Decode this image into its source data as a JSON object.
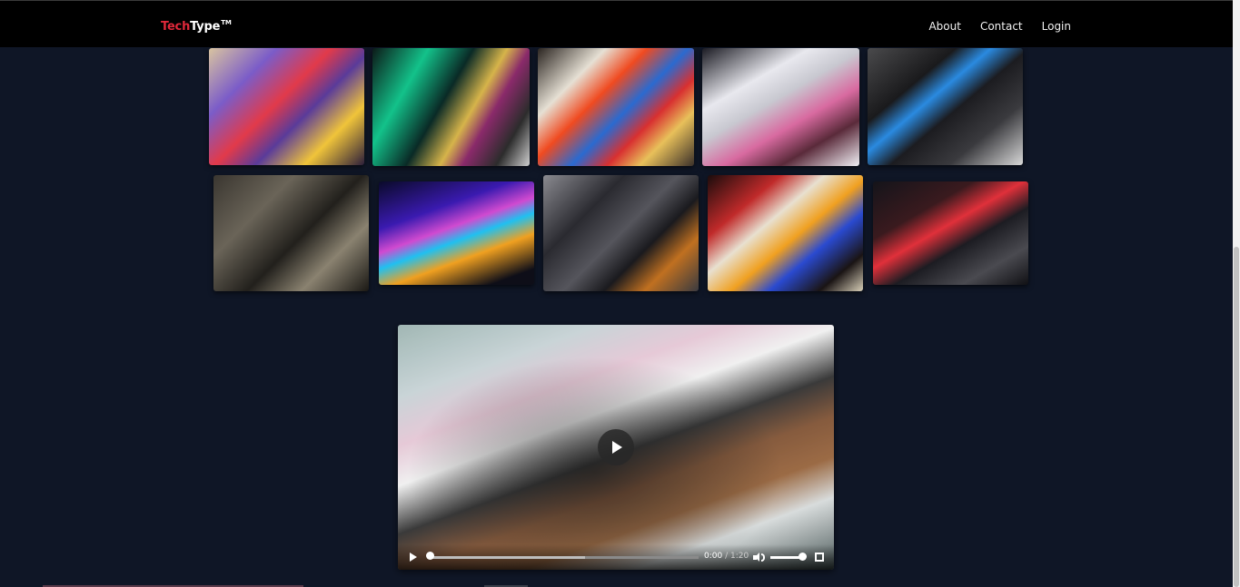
{
  "header": {
    "brand_part1": "Tech",
    "brand_part2": "Type",
    "brand_mark": "TM",
    "nav": [
      {
        "label": "About"
      },
      {
        "label": "Contact"
      },
      {
        "label": "Login"
      }
    ]
  },
  "gallery": {
    "rows": [
      [
        "artisan-keycaps-purple",
        "green-glow-keyboard",
        "character-keycaps",
        "white-pink-keyboards",
        "keyboard-display-case"
      ],
      [
        "beige-retro-keyboard",
        "rgb-rainbow-keyboard",
        "motherboard-cooler",
        "cartoon-keycaps",
        "red-backlit-keyboard"
      ]
    ]
  },
  "video": {
    "current_time": "0:00",
    "separator": "/",
    "duration": "1:20",
    "progress_fraction": 0,
    "buffered_fraction": 0.58,
    "volume_fraction": 1.0
  },
  "colors": {
    "brand_accent": "#e0283a",
    "page_background": "#0f1626",
    "header_background": "#000000"
  },
  "icons": {
    "play": "play-icon",
    "volume": "volume-icon",
    "fullscreen": "fullscreen-icon"
  }
}
